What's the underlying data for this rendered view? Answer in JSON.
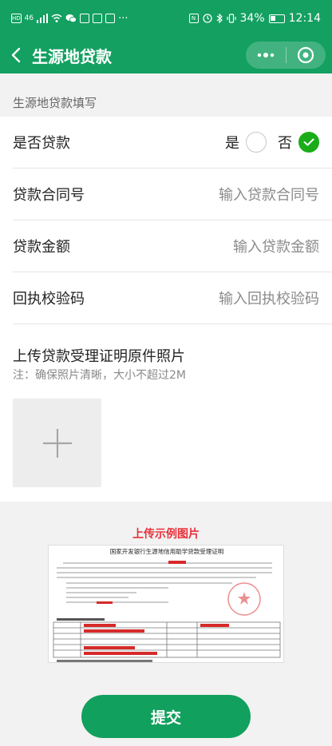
{
  "status_bar": {
    "time": "12:14",
    "battery": "34%",
    "network": "46"
  },
  "nav": {
    "title": "生源地贷款"
  },
  "section_title": "生源地贷款填写",
  "form": {
    "loan": {
      "label": "是否贷款",
      "option_yes": "是",
      "option_no": "否",
      "selected": "否"
    },
    "contract": {
      "label": "贷款合同号",
      "placeholder": "输入贷款合同号"
    },
    "amount": {
      "label": "贷款金额",
      "placeholder": "输入贷款金额"
    },
    "code": {
      "label": "回执校验码",
      "placeholder": "输入回执校验码"
    }
  },
  "upload": {
    "title": "上传贷款受理证明原件照片",
    "note": "注：确保照片清晰，大小不超过2M"
  },
  "example": {
    "label": "上传示例图片",
    "doc_title": "国家开发银行生源地信用助学贷款受理证明"
  },
  "submit_label": "提交",
  "colors": {
    "primary": "#13a061",
    "check": "#1aad19",
    "example_label": "#e8303a"
  },
  "icons": [
    "back-chevron-icon",
    "more-dots-icon",
    "close-circle-icon",
    "checkmark-icon",
    "plus-icon"
  ]
}
